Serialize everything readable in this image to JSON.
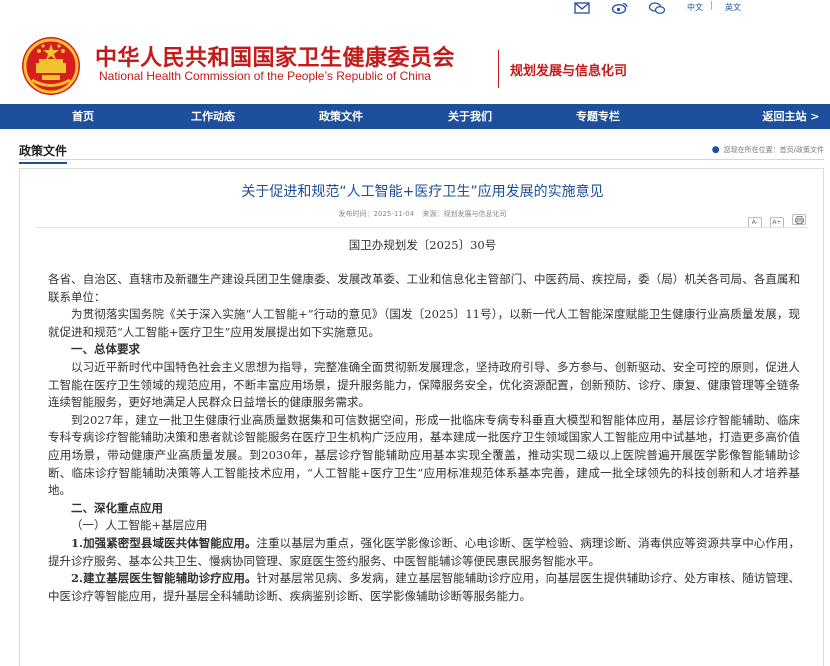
{
  "topbar": {
    "icons": [
      "mail-icon",
      "weibo-icon",
      "wechat-icon"
    ],
    "lang_cn": "中文",
    "lang_sep": "|",
    "lang_en": "英文"
  },
  "header": {
    "title_cn": "中华人民共和国国家卫生健康委员会",
    "title_en": "National Health Commission of the People’s Republic of China",
    "department": "规划发展与信息化司"
  },
  "nav": {
    "items": [
      "首页",
      "工作动态",
      "政策文件",
      "关于我们",
      "专题专栏"
    ],
    "back": "返回主站 >"
  },
  "breadcrumb": {
    "section": "政策文件",
    "location_label": "您现在所在位置：",
    "path": "首页/政策文件"
  },
  "article": {
    "title": "关于促进和规范“人工智能+医疗卫生”应用发展的实施意见",
    "publish_time": "发布时间：2025-11-04",
    "source": "来源：规划发展与信息化司",
    "tools": [
      "A-",
      "A+",
      "print-icon"
    ],
    "doc_number": "国卫办规划发〔2025〕30号",
    "addressee": "各省、自治区、直辖市及新疆生产建设兵团卫生健康委、发展改革委、工业和信息化主管部门、中医药局、疾控局，委（局）机关各司局、各直属和联系单位：",
    "intro": "为贯彻落实国务院《关于深入实施“人工智能+”行动的意见》（国发〔2025〕11号），以新一代人工智能深度赋能卫生健康行业高质量发展，现就促进和规范“人工智能+医疗卫生”应用发展提出如下实施意见。",
    "section1_title": "一、总体要求",
    "section1_p1": "以习近平新时代中国特色社会主义思想为指导，完整准确全面贯彻新发展理念，坚持政府引导、多方参与、创新驱动、安全可控的原则，促进人工智能在医疗卫生领域的规范应用，不断丰富应用场景，提升服务能力，保障服务安全，优化资源配置，创新预防、诊疗、康复、健康管理等全链条连续智能服务，更好地满足人民群众日益增长的健康服务需求。",
    "section1_p2": "到2027年，建立一批卫生健康行业高质量数据集和可信数据空间，形成一批临床专病专科垂直大模型和智能体应用，基层诊疗智能辅助、临床专科专病诊疗智能辅助决策和患者就诊智能服务在医疗卫生机构广泛应用，基本建成一批医疗卫生领域国家人工智能应用中试基地，打造更多高价值应用场景，带动健康产业高质量发展。到2030年，基层诊疗智能辅助应用基本实现全覆盖，推动实现二级以上医院普遍开展医学影像智能辅助诊断、临床诊疗智能辅助决策等人工智能技术应用，“人工智能+医疗卫生”应用标准规范体系基本完善，建成一批全球领先的科技创新和人才培养基地。",
    "section2_title": "二、深化重点应用",
    "section2_sub1": "（一）人工智能+基层应用",
    "item1_title": "1.加强紧密型县域医共体智能应用。",
    "item1_text": "注重以基层为重点，强化医学影像诊断、心电诊断、医学检验、病理诊断、消毒供应等资源共享中心作用，提升诊疗服务、基本公共卫生、慢病协同管理、家庭医生签约服务、中医智能辅诊等便民惠民服务智能水平。",
    "item2_title": "2.建立基层医生智能辅助诊疗应用。",
    "item2_text": "针对基层常见病、多发病，建立基层智能辅助诊疗应用，向基层医生提供辅助诊疗、处方审核、随访管理、中医诊疗等智能应用，提升基层全科辅助诊断、疾病鉴别诊断、医学影像辅助诊断等服务能力。"
  },
  "colors": {
    "brand_red": "#c41a1a",
    "nav_blue": "#1d4f9c",
    "title_blue": "#1f4f9a"
  }
}
